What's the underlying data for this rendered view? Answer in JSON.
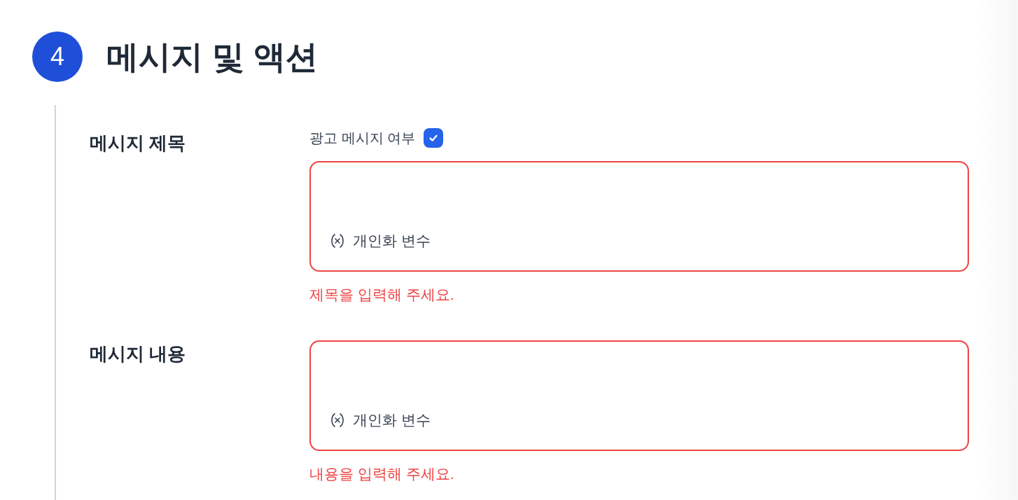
{
  "section": {
    "number": "4",
    "title": "메시지 및 액션"
  },
  "fields": [
    {
      "label": "메시지 제목",
      "checkbox": {
        "label": "광고 메시지 여부",
        "checked": true
      },
      "variable_button": "개인화 변수",
      "invalid": true,
      "error": "제목을 입력해 주세요."
    },
    {
      "label": "메시지 내용",
      "variable_button": "개인화 변수",
      "invalid": true,
      "error": "내용을 입력해 주세요."
    }
  ]
}
